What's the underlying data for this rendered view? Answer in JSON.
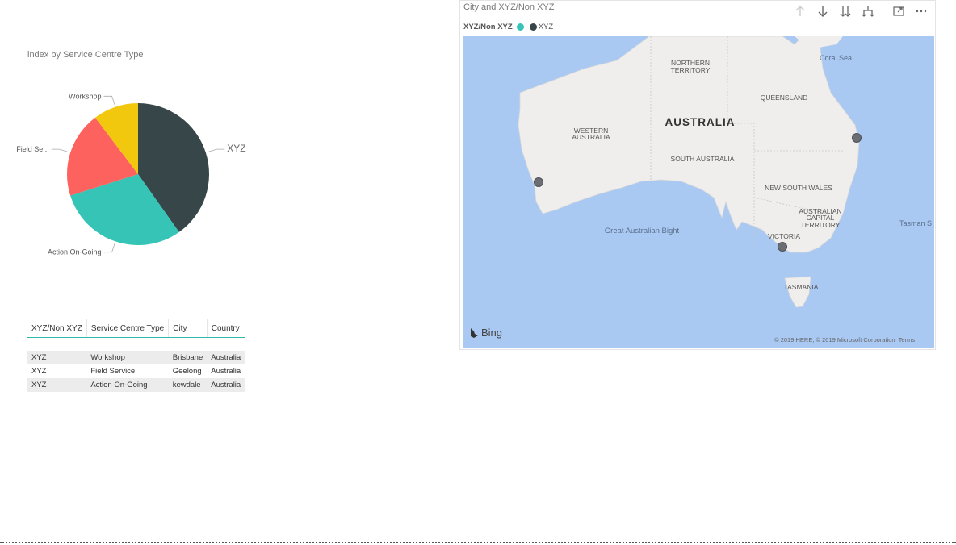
{
  "pie": {
    "title": "index by Service Centre Type",
    "slices": [
      {
        "label": "XYZ",
        "value": 39,
        "color": "#374649"
      },
      {
        "label": "Action On-Going",
        "value": 29,
        "color": "#35c4b5"
      },
      {
        "label": "Field Se...",
        "value": 19,
        "color": "#fd625e"
      },
      {
        "label": "Workshop",
        "value": 10,
        "color": "#f2c80f"
      }
    ]
  },
  "table": {
    "headers": [
      "XYZ/Non XYZ",
      "Service Centre Type",
      "City",
      "Country"
    ],
    "rows": [
      [
        "XYZ",
        "Workshop",
        "Brisbane",
        "Australia"
      ],
      [
        "XYZ",
        "Field Service",
        "Geelong",
        "Australia"
      ],
      [
        "XYZ",
        "Action On-Going",
        "kewdale",
        "Australia"
      ]
    ]
  },
  "map": {
    "title": "City and XYZ/Non XYZ",
    "legend_title": "XYZ/Non XYZ",
    "legend_items": [
      {
        "label": "",
        "color": "#35c4b5"
      },
      {
        "label": "XYZ",
        "color": "#374649"
      }
    ],
    "labels": {
      "australia": "AUSTRALIA",
      "northern_territory_1": "NORTHERN",
      "northern_territory_2": "TERRITORY",
      "queensland": "QUEENSLAND",
      "western_australia_1": "WESTERN",
      "western_australia_2": "AUSTRALIA",
      "south_australia": "SOUTH AUSTRALIA",
      "new_south_wales": "NEW SOUTH WALES",
      "act_1": "AUSTRALIAN",
      "act_2": "CAPITAL",
      "act_3": "TERRITORY",
      "victoria": "VICTORIA",
      "tasmania": "TASMANIA",
      "coral_sea": "Coral Sea",
      "tasman_sea": "Tasman S",
      "great_australian_bight": "Great Australian Bight"
    },
    "bing": "Bing",
    "copyright": "© 2019 HERE, © 2019 Microsoft Corporation",
    "terms": "Terms",
    "colors": {
      "water": "#a9c8f2",
      "land": "#efeeec",
      "marker": "#6b6f73"
    }
  }
}
